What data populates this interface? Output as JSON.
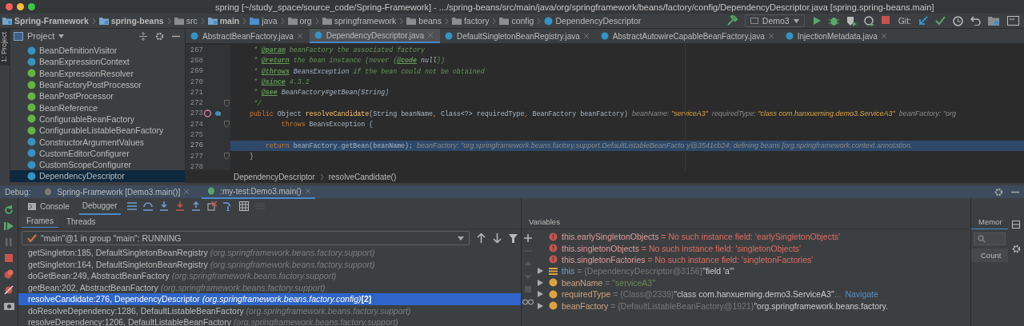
{
  "window": {
    "title": "spring [~/study_space/source_code/Spring-Framework] - .../spring-beans/src/main/java/org/springframework/beans/factory/config/DependencyDescriptor.java [spring.spring-beans.main]"
  },
  "nav_bar": {
    "items": [
      {
        "label": "Spring-Framework",
        "kind": "module"
      },
      {
        "label": "spring-beans",
        "kind": "module"
      },
      {
        "label": "src",
        "kind": "folder"
      },
      {
        "label": "main",
        "kind": "module"
      },
      {
        "label": "java",
        "kind": "source"
      },
      {
        "label": "org",
        "kind": "folder"
      },
      {
        "label": "springframework",
        "kind": "folder"
      },
      {
        "label": "beans",
        "kind": "folder"
      },
      {
        "label": "factory",
        "kind": "folder"
      },
      {
        "label": "config",
        "kind": "folder"
      },
      {
        "label": "DependencyDescriptor",
        "kind": "class"
      }
    ],
    "run_config": "Demo3",
    "git_label": "Git:"
  },
  "side_tab": "1: Project",
  "project_panel": {
    "title": "Project",
    "items": [
      {
        "name": "BeanDefinitionVisitor",
        "kind": "class",
        "selected": false
      },
      {
        "name": "BeanExpressionContext",
        "kind": "class",
        "selected": false
      },
      {
        "name": "BeanExpressionResolver",
        "kind": "interface",
        "selected": false
      },
      {
        "name": "BeanFactoryPostProcessor",
        "kind": "interface",
        "selected": false
      },
      {
        "name": "BeanPostProcessor",
        "kind": "interface",
        "selected": false
      },
      {
        "name": "BeanReference",
        "kind": "interface",
        "selected": false
      },
      {
        "name": "ConfigurableBeanFactory",
        "kind": "interface",
        "selected": false
      },
      {
        "name": "ConfigurableListableBeanFactory",
        "kind": "interface",
        "selected": false
      },
      {
        "name": "ConstructorArgumentValues",
        "kind": "class",
        "selected": false
      },
      {
        "name": "CustomEditorConfigurer",
        "kind": "class",
        "selected": false
      },
      {
        "name": "CustomScopeConfigurer",
        "kind": "class",
        "selected": false
      },
      {
        "name": "DependencyDescriptor",
        "kind": "class",
        "selected": true
      }
    ]
  },
  "editor_tabs": [
    {
      "label": "AbstractBeanFactory.java",
      "selected": false
    },
    {
      "label": "DependencyDescriptor.java",
      "selected": true
    },
    {
      "label": "DefaultSingletonBeanRegistry.java",
      "selected": false
    },
    {
      "label": "AbstractAutowireCapableBeanFactory.java",
      "selected": false
    },
    {
      "label": "InjectionMetadata.java",
      "selected": false
    }
  ],
  "code": {
    "lines": [
      {
        "number": "267",
        "current": false,
        "fold": false,
        "gutter_icons": false,
        "tokens": [
          {
            "kind": "comment",
            "text": "     * "
          },
          {
            "kind": "tag",
            "text": "@param"
          },
          {
            "kind": "comment",
            "text": " beanFactory the associated factory"
          }
        ]
      },
      {
        "number": "268",
        "current": false,
        "fold": false,
        "gutter_icons": false,
        "tokens": [
          {
            "kind": "comment",
            "text": "     * "
          },
          {
            "kind": "tag",
            "text": "@return"
          },
          {
            "kind": "comment",
            "text": " the bean instance (never {"
          },
          {
            "kind": "tag",
            "text": "@code"
          },
          {
            "kind": "docref",
            "text": " null"
          },
          {
            "kind": "comment",
            "text": "})"
          }
        ]
      },
      {
        "number": "269",
        "current": false,
        "fold": false,
        "gutter_icons": false,
        "tokens": [
          {
            "kind": "comment",
            "text": "     * "
          },
          {
            "kind": "tag",
            "text": "@throws"
          },
          {
            "kind": "docref",
            "text": " BeansException"
          },
          {
            "kind": "comment",
            "text": " if the bean could not be obtained"
          }
        ]
      },
      {
        "number": "270",
        "current": false,
        "fold": false,
        "gutter_icons": false,
        "tokens": [
          {
            "kind": "comment",
            "text": "     * "
          },
          {
            "kind": "tag",
            "text": "@since"
          },
          {
            "kind": "comment",
            "text": " 4.3.2"
          }
        ]
      },
      {
        "number": "271",
        "current": false,
        "fold": false,
        "gutter_icons": false,
        "tokens": [
          {
            "kind": "comment",
            "text": "     * "
          },
          {
            "kind": "tag",
            "text": "@see"
          },
          {
            "kind": "docref",
            "text": " BeanFactory#getBean(String)"
          }
        ]
      },
      {
        "number": "272",
        "current": false,
        "fold": true,
        "gutter_icons": false,
        "tokens": [
          {
            "kind": "comment",
            "text": "     */"
          }
        ]
      },
      {
        "number": "273",
        "current": false,
        "fold": false,
        "gutter_icons": true,
        "tokens": [
          {
            "kind": "keyword",
            "text": "    public "
          },
          {
            "kind": "plain",
            "text": "Object "
          },
          {
            "kind": "method",
            "text": "resolveCandidate"
          },
          {
            "kind": "plain",
            "text": "(String beanName"
          },
          {
            "kind": "keyword",
            "text": ", "
          },
          {
            "kind": "plain",
            "text": "Class<?> requiredType"
          },
          {
            "kind": "keyword",
            "text": ", "
          },
          {
            "kind": "plain",
            "text": "BeanFactory beanFactory)"
          },
          {
            "kind": "hint",
            "text": "  beanName: "
          },
          {
            "kind": "hint_value",
            "text": "\"serviceA3\""
          },
          {
            "kind": "hint",
            "text": "  requiredType: "
          },
          {
            "kind": "hint_value",
            "text": "\"class com.hanxueming.demo3.ServiceA3\""
          },
          {
            "kind": "hint",
            "text": "  beanFactory: \"org"
          }
        ]
      },
      {
        "number": "274",
        "current": false,
        "fold": true,
        "gutter_icons": false,
        "tokens": [
          {
            "kind": "keyword",
            "text": "            throws "
          },
          {
            "kind": "plain",
            "text": "BeansException {"
          }
        ]
      },
      {
        "number": "275",
        "current": false,
        "fold": false,
        "gutter_icons": false
      },
      {
        "number": "276",
        "current": true,
        "fold": false,
        "gutter_icons": false,
        "tokens": [
          {
            "kind": "keyword",
            "text": "        return "
          },
          {
            "kind": "plain",
            "text": "beanFactory.getBean(beanName);"
          },
          {
            "kind": "hint",
            "text": "  beanFactory: \"org.springframework.beans.factory.support.DefaultListableBeanFactory@3541cb24: defining beans [org.springframework.context.annotation."
          }
        ]
      },
      {
        "number": "277",
        "current": false,
        "fold": true,
        "gutter_icons": false,
        "tokens": [
          {
            "kind": "plain",
            "text": "    }"
          }
        ]
      },
      {
        "number": "278",
        "current": false,
        "fold": false,
        "gutter_icons": false
      }
    ]
  },
  "breadcrumbs": [
    "DependencyDescriptor",
    "resolveCandidate()"
  ],
  "debug": {
    "label": "Debug:",
    "sessions": [
      {
        "label": "Spring-Framework [Demo3.main()]",
        "selected": false
      },
      {
        "label": ":my-test:Demo3.main()",
        "selected": true
      }
    ],
    "tabs": [
      {
        "label": "Console",
        "selected": false
      },
      {
        "label": "Debugger",
        "selected": true
      }
    ],
    "subtabs": [
      {
        "label": "Frames",
        "selected": true
      },
      {
        "label": "Threads",
        "selected": false
      }
    ],
    "thread": "\"main\"@1 in group \"main\": RUNNING",
    "frames": [
      {
        "method": "getSingleton:185, DefaultSingletonBeanRegistry",
        "package": "(org.springframework.beans.factory.support)",
        "selected": false
      },
      {
        "method": "getSingleton:164, DefaultSingletonBeanRegistry",
        "package": "(org.springframework.beans.factory.support)",
        "selected": false
      },
      {
        "method": "doGetBean:249, AbstractBeanFactory",
        "package": "(org.springframework.beans.factory.support)",
        "selected": false
      },
      {
        "method": "getBean:202, AbstractBeanFactory",
        "package": "(org.springframework.beans.factory.support)",
        "selected": false
      },
      {
        "method": "resolveCandidate:276, DependencyDescriptor",
        "package": "(org.springframework.beans.factory.config)",
        "extra": "[2]",
        "selected": true
      },
      {
        "method": "doResolveDependency:1286, DefaultListableBeanFactory",
        "package": "(org.springframework.beans.factory.support)",
        "selected": false
      },
      {
        "method": "resolveDependency:1206, DefaultListableBeanFactory",
        "package": "(org.springframework.beans.factory.support)",
        "selected": false
      }
    ],
    "variables": {
      "title": "Variables",
      "items": [
        {
          "kind": "error",
          "expandable": false,
          "name": "this.earlySingletonObjects",
          "separator": "=",
          "value": "No such instance field: 'earlySingletonObjects'",
          "color": "#e06c5f"
        },
        {
          "kind": "error",
          "expandable": false,
          "name": "this.singletonObjects",
          "separator": "=",
          "value": "No such instance field: 'singletonObjects'",
          "color": "#e06c5f"
        },
        {
          "kind": "error",
          "expandable": false,
          "name": "this.singletonFactories",
          "separator": "=",
          "value": "No such instance field: 'singletonFactories'",
          "color": "#e06c5f"
        },
        {
          "kind": "object",
          "expandable": true,
          "name": "this",
          "separator": "=",
          "type": "{DependencyDescriptor@3156}",
          "value": "\"field 'a'\"",
          "color": "#cccccc"
        },
        {
          "kind": "param",
          "expandable": true,
          "name": "beanName",
          "separator": "=",
          "value": "\"serviceA3\"",
          "color": "#6a8759"
        },
        {
          "kind": "param",
          "expandable": true,
          "name": "requiredType",
          "separator": "=",
          "type": "{Class@2339}",
          "value": "\"class com.hanxueming.demo3.ServiceA3\"",
          "color": "#cccccc",
          "more": "...",
          "link": "Navigate"
        },
        {
          "kind": "param",
          "expandable": true,
          "name": "beanFactory",
          "separator": "=",
          "type": "{DefaultListableBeanFactory@1921}",
          "value": "\"org.springframework.beans.factory.",
          "color": "#cccccc"
        }
      ]
    },
    "memory": {
      "title": "Memor",
      "column": "Count"
    }
  }
}
